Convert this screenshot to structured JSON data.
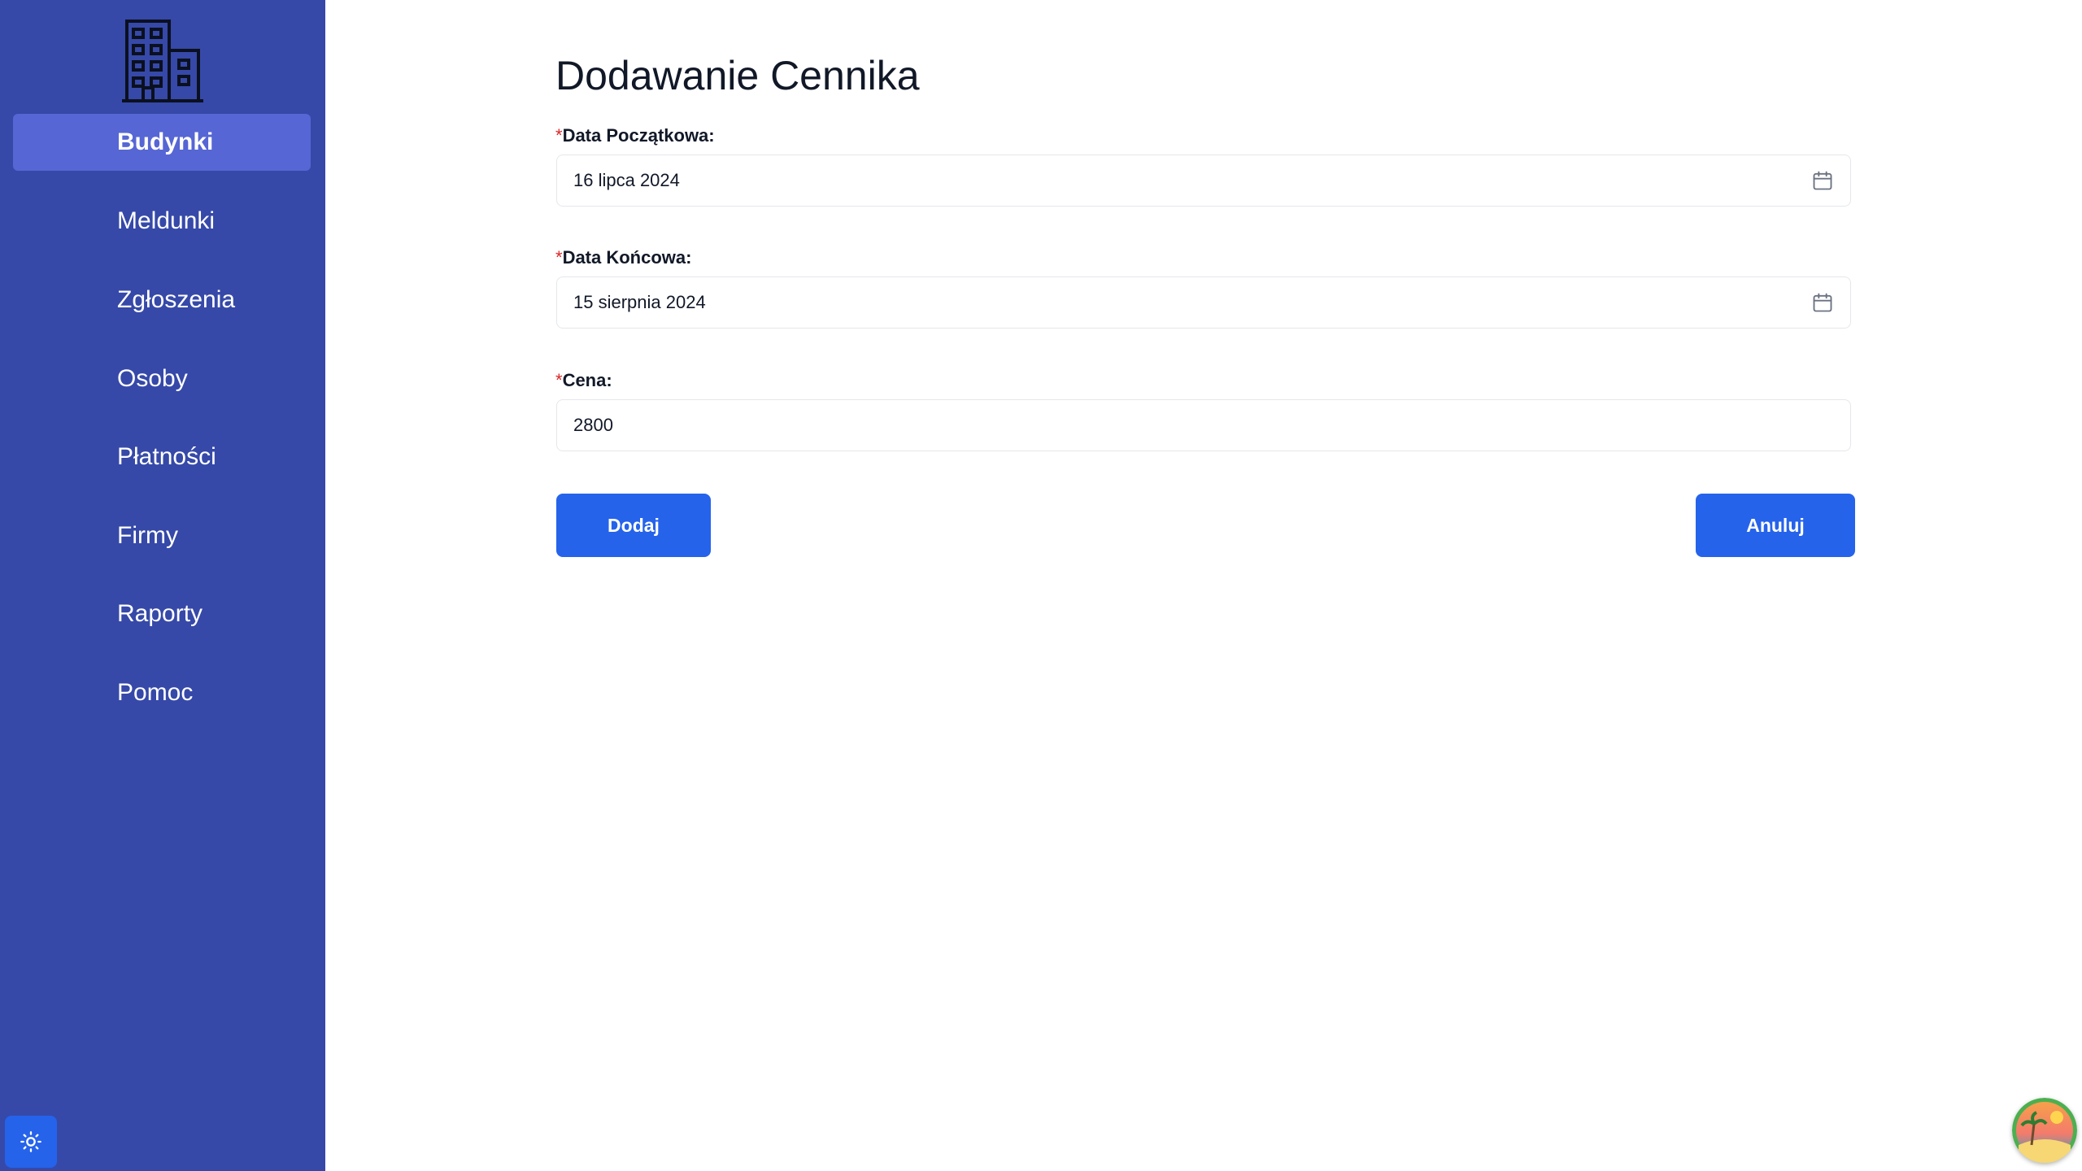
{
  "sidebar": {
    "logo_icon": "building-icon",
    "items": [
      {
        "label": "Budynki",
        "active": true
      },
      {
        "label": "Meldunki"
      },
      {
        "label": "Zgłoszenia"
      },
      {
        "label": "Osoby"
      },
      {
        "label": "Płatności"
      },
      {
        "label": "Firmy"
      },
      {
        "label": "Raporty"
      },
      {
        "label": "Pomoc"
      }
    ],
    "theme_toggle_icon": "sun-icon"
  },
  "main": {
    "title": "Dodawanie Cennika",
    "fields": {
      "start_date": {
        "required_mark": "*",
        "label": "Data Początkowa:",
        "value": "16 lipca 2024",
        "icon": "calendar-icon"
      },
      "end_date": {
        "required_mark": "*",
        "label": "Data Końcowa:",
        "value": "15 sierpnia 2024",
        "icon": "calendar-icon"
      },
      "price": {
        "required_mark": "*",
        "label": "Cena:",
        "value": "2800"
      }
    },
    "buttons": {
      "add": "Dodaj",
      "cancel": "Anuluj"
    }
  },
  "colors": {
    "sidebar_bg": "#3649a8",
    "sidebar_active": "#5666d4",
    "primary": "#2563eb",
    "required": "#dc2626"
  }
}
